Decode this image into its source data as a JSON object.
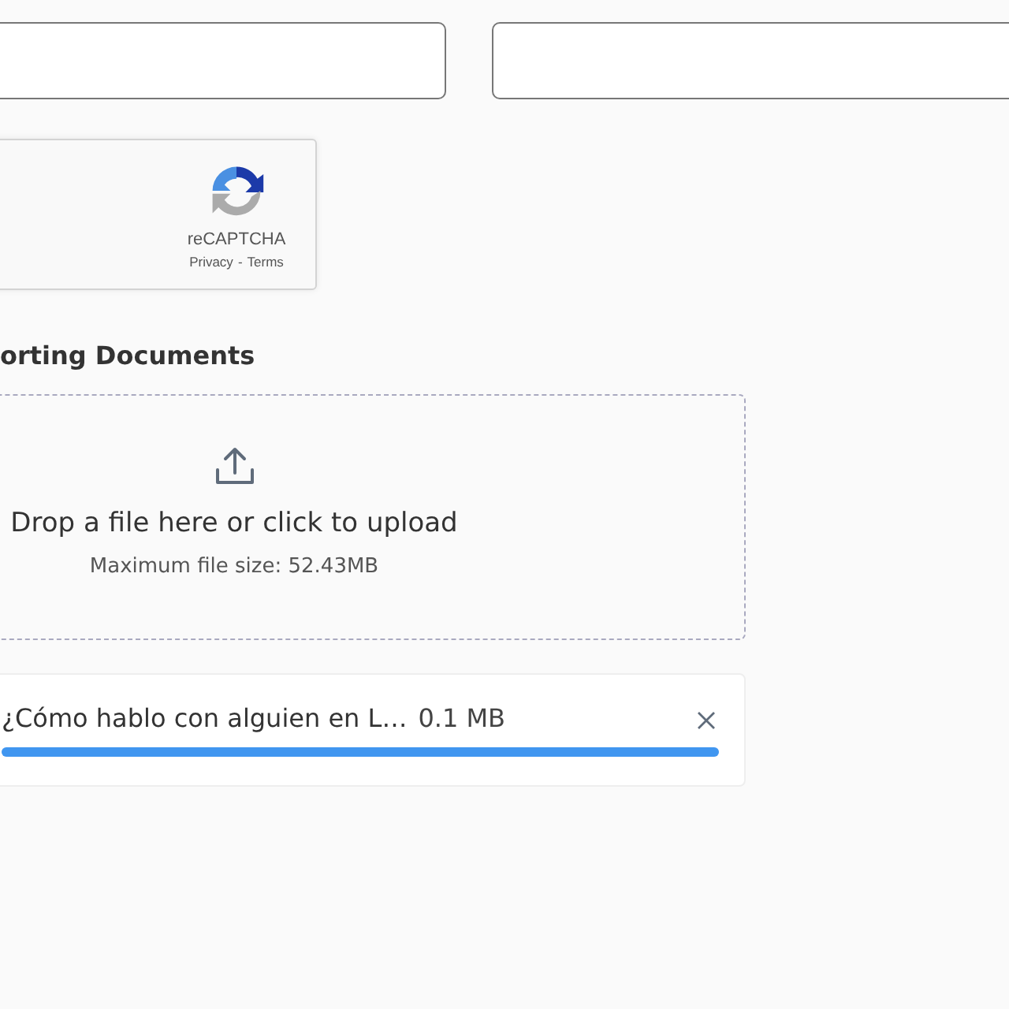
{
  "fields": [
    {
      "kind": "text"
    },
    {
      "kind": "text"
    }
  ],
  "captcha": {
    "brand": "reCAPTCHA",
    "links": [
      "Privacy",
      "Terms"
    ],
    "separator": "-"
  },
  "section": {
    "heading": "orting Documents"
  },
  "dropzone": {
    "title": "Drop a file here or click to upload",
    "hint": "Maximum file size: 52.43MB"
  },
  "files": [
    {
      "name": "¿Cómo hablo con alguien en L…",
      "size": "0.1 MB",
      "level": 1
    }
  ]
}
